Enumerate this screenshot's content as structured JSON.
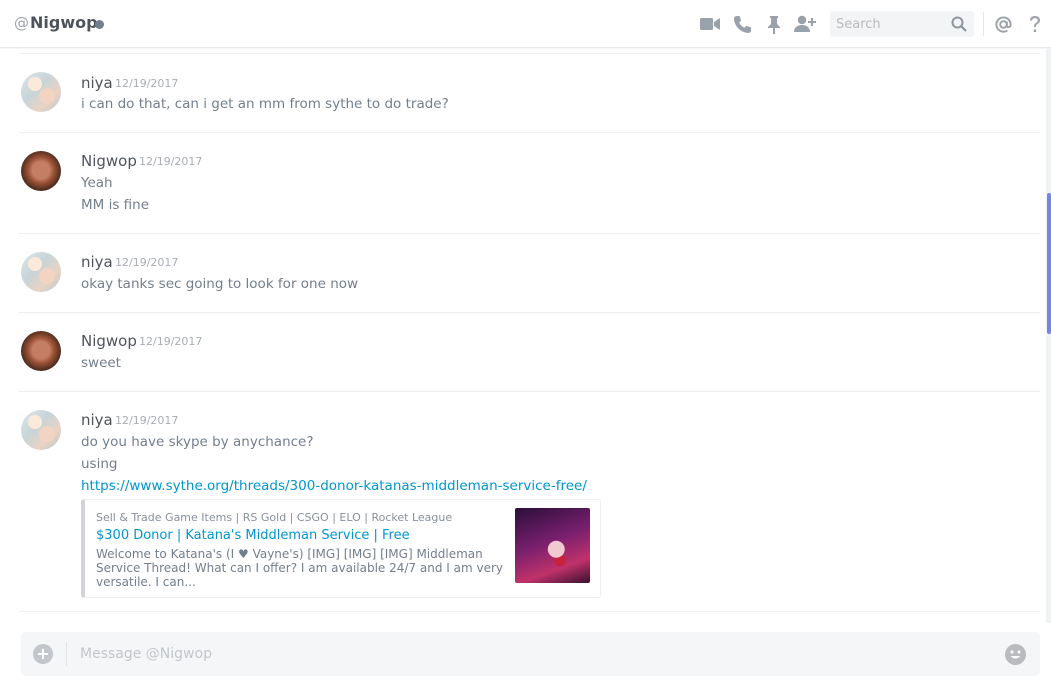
{
  "header": {
    "at_symbol": "@",
    "title": "Nigwop",
    "search_placeholder": "Search",
    "icons": [
      "video-call-icon",
      "voice-call-icon",
      "pin-icon",
      "add-friend-icon",
      "search-icon",
      "mention-icon",
      "help-icon"
    ]
  },
  "messages": [
    {
      "author": "niya",
      "timestamp": "12/19/2017",
      "lines": [
        "i can do that, can i get an mm from sythe to do trade?"
      ]
    },
    {
      "author": "Nigwop",
      "timestamp": "12/19/2017",
      "lines": [
        "Yeah",
        "MM is fine"
      ]
    },
    {
      "author": "niya",
      "timestamp": "12/19/2017",
      "lines": [
        "okay tanks sec going to look for one now"
      ]
    },
    {
      "author": "Nigwop",
      "timestamp": "12/19/2017",
      "lines": [
        "sweet"
      ]
    },
    {
      "author": "niya",
      "timestamp": "12/19/2017",
      "lines": [
        "do you have skype by anychance?",
        "using"
      ],
      "link": "https://www.sythe.org/threads/300-donor-katanas-middleman-service-free/",
      "embed": {
        "provider": "Sell & Trade Game Items | RS Gold | CSGO | ELO | Rocket League",
        "title": "$300 Donor | Katana's Middleman Service | Free",
        "description": "Welcome to Katana's (I ♥ Vayne's) [IMG] [IMG] [IMG] Middleman Service Thread! What can I offer? I am available 24/7 and I am very versatile. I can..."
      }
    }
  ],
  "composer": {
    "placeholder": "Message @Nigwop"
  },
  "colors": {
    "accent": "#7289da",
    "link": "#0096cf"
  }
}
